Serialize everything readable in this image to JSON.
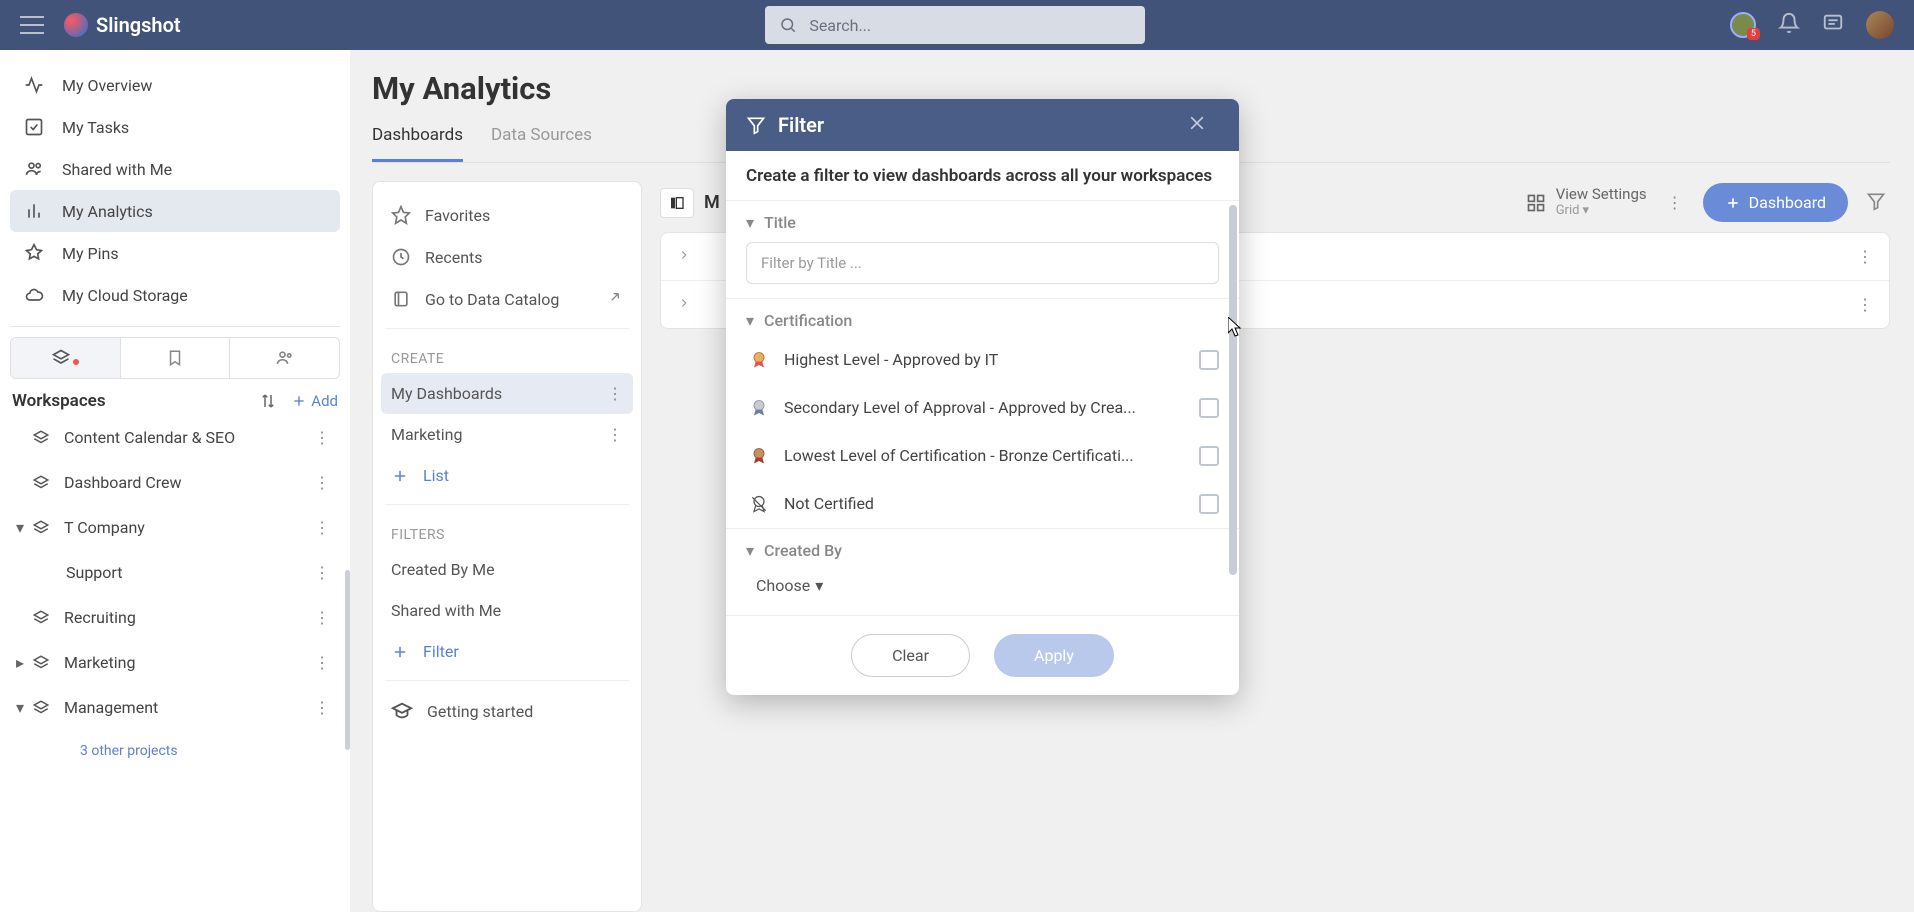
{
  "app": {
    "name": "Slingshot",
    "search_placeholder": "Search...",
    "notif_count": "5"
  },
  "sidebar": {
    "items": [
      {
        "label": "My Overview"
      },
      {
        "label": "My Tasks"
      },
      {
        "label": "Shared with Me"
      },
      {
        "label": "My Analytics"
      },
      {
        "label": "My Pins"
      },
      {
        "label": "My Cloud Storage"
      }
    ],
    "workspaces_label": "Workspaces",
    "add_label": "Add",
    "workspaces": [
      {
        "name": "Content Calendar & SEO"
      },
      {
        "name": "Dashboard Crew"
      },
      {
        "name": "T Company"
      },
      {
        "name": "Support"
      },
      {
        "name": "Recruiting"
      },
      {
        "name": "Marketing"
      },
      {
        "name": "Management"
      }
    ],
    "other_projects": "3 other projects"
  },
  "page": {
    "title": "My Analytics",
    "tabs": [
      "Dashboards",
      "Data Sources"
    ]
  },
  "center": {
    "favorites": "Favorites",
    "recents": "Recents",
    "catalog": "Go to Data Catalog",
    "create_label": "CREATE",
    "my_dashboards": "My Dashboards",
    "marketing": "Marketing",
    "list": "List",
    "filters_label": "FILTERS",
    "created_by_me": "Created By Me",
    "shared_with_me": "Shared with Me",
    "filter": "Filter",
    "getting": "Getting started"
  },
  "grid": {
    "title_prefix": "M",
    "view_settings": "View Settings",
    "view_mode": "Grid",
    "new_dashboard": "Dashboard"
  },
  "modal": {
    "title": "Filter",
    "subtitle": "Create a filter to view dashboards across all your workspaces",
    "section_title": "Title",
    "title_placeholder": "Filter by Title ...",
    "section_cert": "Certification",
    "cert_items": [
      "Highest Level - Approved by IT",
      "Secondary Level of Approval - Approved by Crea...",
      "Lowest Level of Certification - Bronze Certificati...",
      "Not Certified"
    ],
    "section_created": "Created By",
    "choose": "Choose",
    "clear": "Clear",
    "apply": "Apply"
  }
}
